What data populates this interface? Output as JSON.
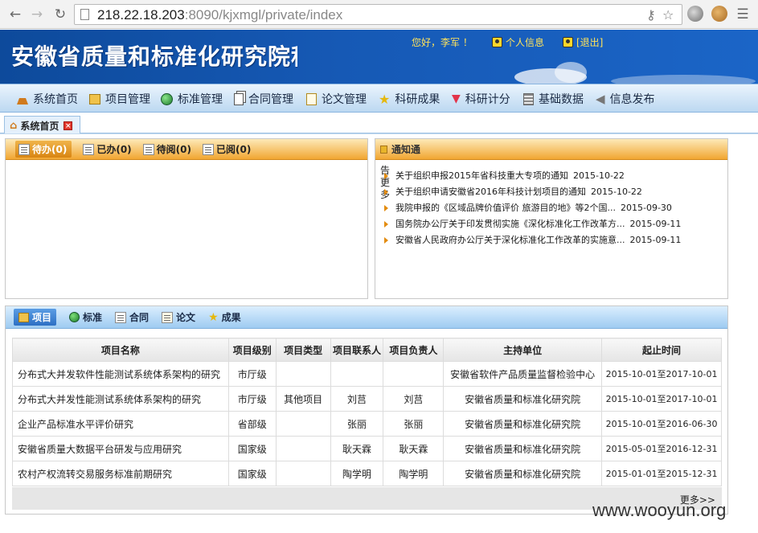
{
  "browser": {
    "back_icon": "back-arrow-icon",
    "forward_icon": "forward-arrow-icon",
    "reload_icon": "reload-icon",
    "url_host": "218.22.18.203",
    "url_rest": ":8090/kjxmgl/private/index"
  },
  "header": {
    "title": "安徽省质量和标准化研究院科",
    "greeting": "您好，李军 ！",
    "profile_link": "个人信息",
    "logout_link": "[退出]"
  },
  "menu": [
    {
      "label": "系统首页",
      "icon": "home-icon"
    },
    {
      "label": "项目管理",
      "icon": "box-icon"
    },
    {
      "label": "标准管理",
      "icon": "globe-icon"
    },
    {
      "label": "合同管理",
      "icon": "document-icon"
    },
    {
      "label": "论文管理",
      "icon": "edit-icon"
    },
    {
      "label": "科研成果",
      "icon": "star-icon"
    },
    {
      "label": "科研计分",
      "icon": "gem-icon"
    },
    {
      "label": "基础数据",
      "icon": "database-icon"
    },
    {
      "label": "信息发布",
      "icon": "back-icon"
    }
  ],
  "tab": {
    "label": "系统首页"
  },
  "tasks": {
    "tabs": [
      "待办(0)",
      "已办(0)",
      "待阅(0)",
      "已阅(0)"
    ]
  },
  "notice": {
    "title": "通知通",
    "side_text": "告 更多",
    "items": [
      {
        "title": "关于组织申报2015年省科技重大专项的通知",
        "date": "2015-10-22"
      },
      {
        "title": "关于组织申请安徽省2016年科技计划项目的通知",
        "date": "2015-10-22"
      },
      {
        "title": "我院申报的《区域品牌价值评价 旅游目的地》等2个国...",
        "date": "2015-09-30"
      },
      {
        "title": "国务院办公厅关于印发贯彻实施《深化标准化工作改革方...",
        "date": "2015-09-11"
      },
      {
        "title": "安徽省人民政府办公厅关于深化标准化工作改革的实施意...",
        "date": "2015-09-11"
      }
    ]
  },
  "projects": {
    "tabs": [
      "项目",
      "标准",
      "合同",
      "论文",
      "成果"
    ],
    "columns": [
      "项目名称",
      "项目级别",
      "项目类型",
      "项目联系人",
      "项目负责人",
      "主持单位",
      "起止时间"
    ],
    "rows": [
      [
        "分布式大并发软件性能测试系统体系架构的研究",
        "市厅级",
        "",
        "",
        "",
        "安徽省软件产品质量监督检验中心",
        "2015-10-01至2017-10-01"
      ],
      [
        "分布式大并发性能测试系统体系架构的研究",
        "市厅级",
        "其他项目",
        "刘莒",
        "刘莒",
        "安徽省质量和标准化研究院",
        "2015-10-01至2017-10-01"
      ],
      [
        "企业产品标准水平评价研究",
        "省部级",
        "",
        "张丽",
        "张丽",
        "安徽省质量和标准化研究院",
        "2015-10-01至2016-06-30"
      ],
      [
        "安徽省质量大数据平台研发与应用研究",
        "国家级",
        "",
        "耿天霖",
        "耿天霖",
        "安徽省质量和标准化研究院",
        "2015-05-01至2016-12-31"
      ],
      [
        "农村产权流转交易服务标准前期研究",
        "国家级",
        "",
        "陶学明",
        "陶学明",
        "安徽省质量和标准化研究院",
        "2015-01-01至2015-12-31"
      ]
    ],
    "more": "更多>>"
  },
  "watermark": "www.wooyun.org"
}
